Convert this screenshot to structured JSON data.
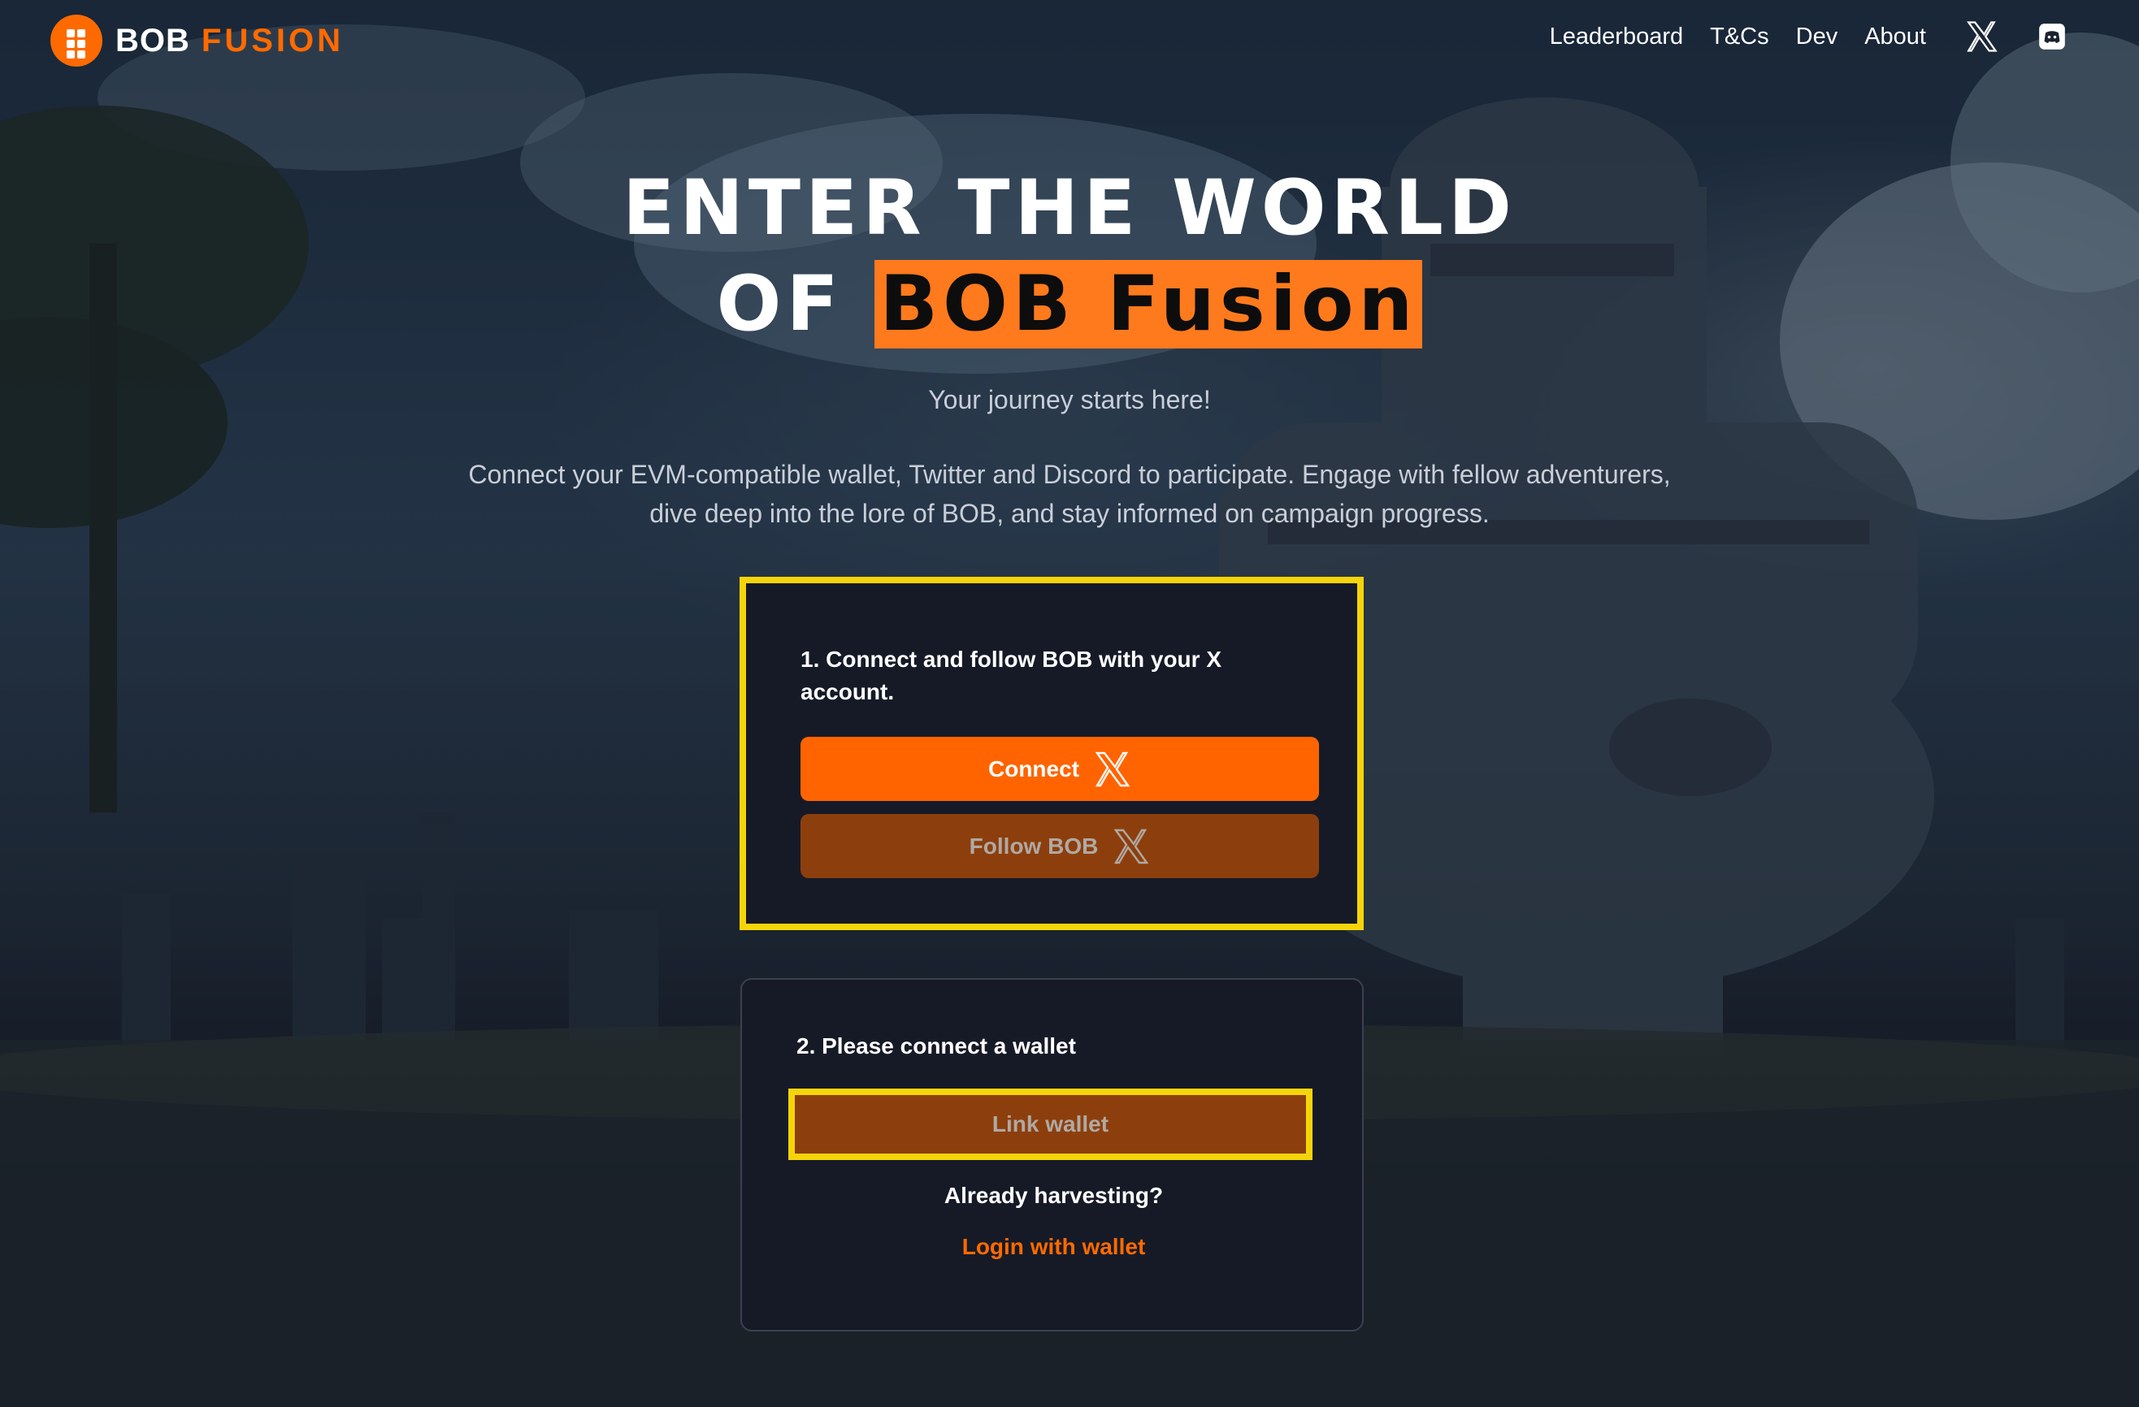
{
  "header": {
    "logo_bob": "BOB",
    "logo_fusion": "FUSION",
    "nav": [
      {
        "label": "Leaderboard"
      },
      {
        "label": "T&Cs"
      },
      {
        "label": "Dev"
      },
      {
        "label": "About"
      }
    ],
    "icons": [
      "x-logo-icon",
      "discord-icon"
    ]
  },
  "hero": {
    "line1": "ENTER THE WORLD",
    "line2_prefix": "OF",
    "line2_highlight": "BOB Fusion",
    "subtitle": "Your journey starts here!",
    "description": "Connect your EVM-compatible wallet, Twitter and Discord to participate. Engage with fellow adventurers, dive deep into the lore of BOB, and stay informed on campaign progress."
  },
  "step1": {
    "title": "1. Connect and follow BOB with your X account.",
    "connect_label": "Connect",
    "follow_label": "Follow BOB"
  },
  "step2": {
    "title": "2. Please connect a wallet",
    "link_label": "Link wallet",
    "already": "Already harvesting?",
    "login_label": "Login with wallet"
  },
  "colors": {
    "accent": "#ff6400",
    "accent_dim": "#8c3f0d",
    "highlight_border": "#f6d40a",
    "card_bg": "#161a27"
  }
}
